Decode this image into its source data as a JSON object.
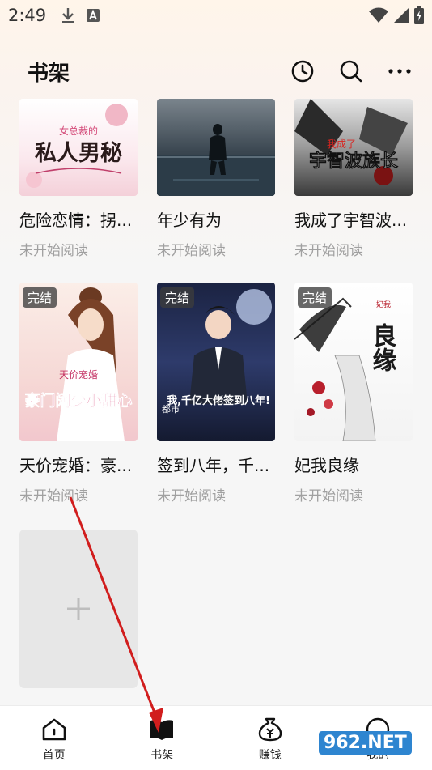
{
  "status_bar": {
    "time": "2:49"
  },
  "header": {
    "title": "书架"
  },
  "books": [
    {
      "title": "危险恋情：拐...",
      "status": "未开始阅读",
      "badge": "",
      "cover_text": "私人男秘",
      "cover_sub": "女总裁的"
    },
    {
      "title": "年少有为",
      "status": "未开始阅读",
      "badge": "",
      "cover_text": "",
      "cover_sub": ""
    },
    {
      "title": "我成了宇智波...",
      "status": "未开始阅读",
      "badge": "",
      "cover_text": "宇智波族长",
      "cover_sub": "我成了"
    },
    {
      "title": "天价宠婚：豪...",
      "status": "未开始阅读",
      "badge": "完结",
      "cover_text": "豪门阔少小甜心",
      "cover_sub": "天价宠婚"
    },
    {
      "title": "签到八年，千...",
      "status": "未开始阅读",
      "badge": "完结",
      "cover_text": "我,千亿大佬签到八年!",
      "cover_sub": "都市"
    },
    {
      "title": "妃我良缘",
      "status": "未开始阅读",
      "badge": "完结",
      "cover_text": "良缘",
      "cover_sub": "妃我"
    }
  ],
  "nav": [
    {
      "label": "首页",
      "icon": "home-icon"
    },
    {
      "label": "书架",
      "icon": "bookshelf-icon",
      "active": true
    },
    {
      "label": "赚钱",
      "icon": "money-bag-icon"
    },
    {
      "label": "我的",
      "icon": "profile-icon"
    }
  ],
  "watermark": {
    "text": "962.NET"
  },
  "colors": {
    "accent": "#111111",
    "arrow": "#d11d1d",
    "muted": "#a0a0a0"
  }
}
